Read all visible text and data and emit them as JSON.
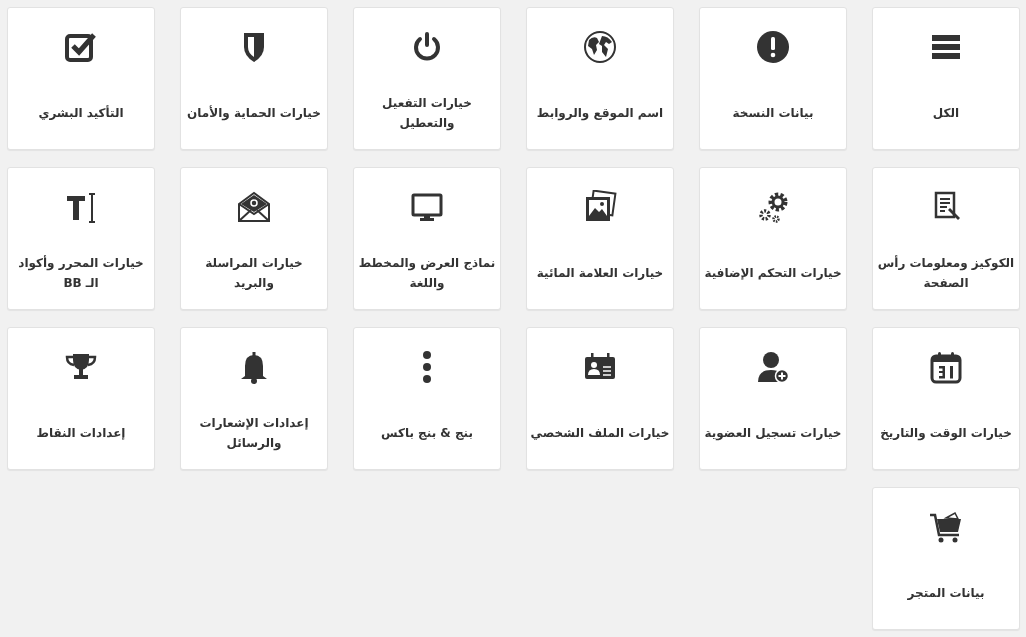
{
  "tiles": [
    {
      "label": "الكل"
    },
    {
      "label": "بيانات النسخة"
    },
    {
      "label": "اسم الموقع والروابط"
    },
    {
      "label": "خيارات التفعيل والتعطيل"
    },
    {
      "label": "خيارات الحماية والأمان"
    },
    {
      "label": "التأكيد البشري"
    },
    {
      "label": "الكوكيز ومعلومات رأس الصفحة"
    },
    {
      "label": "خيارات التحكم الإضافية"
    },
    {
      "label": "خيارات العلامة المائية"
    },
    {
      "label": "نماذج العرض والمخطط واللغة"
    },
    {
      "label": "خيارات المراسلة والبريد"
    },
    {
      "label": "خيارات المحرر وأكواد الـ BB"
    },
    {
      "label": "خيارات الوقت والتاريخ"
    },
    {
      "label": "خيارات تسجيل العضوية"
    },
    {
      "label": "خيارات الملف الشخصي"
    },
    {
      "label": "بنج & بنج باكس"
    },
    {
      "label": "إعدادات الإشعارات والرسائل"
    },
    {
      "label": "إعدادات النقاط"
    },
    {
      "label": "بيانات المتجر"
    }
  ]
}
